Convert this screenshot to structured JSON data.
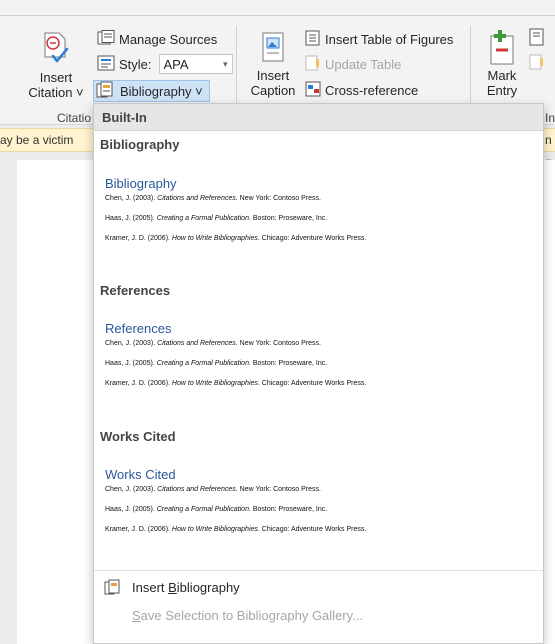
{
  "ribbon": {
    "insert_citation": {
      "line1": "Insert",
      "line2": "Citation ˅"
    },
    "manage_sources": "Manage Sources",
    "style_label": "Style:",
    "style_value": "APA",
    "bibliography_label": "Bibliography ˅",
    "citations_group_label": "Citatio",
    "insert_caption": {
      "line1": "Insert",
      "line2": "Caption"
    },
    "insert_table_of_figures": "Insert Table of Figures",
    "update_table": "Update Table",
    "cross_reference": "Cross-reference",
    "mark_entry": {
      "line1": "Mark",
      "line2": "Entry"
    },
    "index_group_label": "In"
  },
  "infobar": {
    "left_text": "ay be a victim",
    "right_text": "n g"
  },
  "dropdown": {
    "header": "Built-In",
    "items": [
      {
        "title": "Bibliography",
        "heading": "Bibliography",
        "entries": [
          {
            "author": "Chen, J. (2003). ",
            "work": "Citations and References",
            "rest": ". New York: Contoso Press."
          },
          {
            "author": "Haas, J. (2005). ",
            "work": "Creating a Formal Publication",
            "rest": ". Boston: Proseware, Inc."
          },
          {
            "author": "Kramer, J. D. (2006). ",
            "work": "How to Write Bibliographies",
            "rest": ". Chicago: Adventure Works Press."
          }
        ]
      },
      {
        "title": "References",
        "heading": "References",
        "entries": [
          {
            "author": "Chen, J. (2003). ",
            "work": "Citations and References",
            "rest": ". New York: Contoso Press."
          },
          {
            "author": "Haas, J. (2005). ",
            "work": "Creating a Formal Publication",
            "rest": ". Boston: Proseware, Inc."
          },
          {
            "author": "Kramer, J. D. (2006). ",
            "work": "How to Write Bibliographies",
            "rest": ". Chicago: Adventure Works Press."
          }
        ]
      },
      {
        "title": "Works Cited",
        "heading": "Works Cited",
        "entries": [
          {
            "author": "Chen, J. (2003). ",
            "work": "Citations and References",
            "rest": ". New York: Contoso Press."
          },
          {
            "author": "Haas, J. (2005). ",
            "work": "Creating a Formal Publication",
            "rest": ". Boston: Proseware, Inc."
          },
          {
            "author": "Kramer, J. D. (2006). ",
            "work": "How to Write Bibliographies",
            "rest": ". Chicago: Adventure Works Press."
          }
        ]
      }
    ],
    "insert_bibliography": {
      "pre": "Insert ",
      "u": "B",
      "post": "ibliography"
    },
    "save_selection": {
      "u": "S",
      "post": "ave Selection to Bibliography Gallery..."
    }
  },
  "colors": {
    "accent": "#2b579a",
    "infobar": "#fff4ce",
    "selected_button": "#cfe3f7"
  }
}
